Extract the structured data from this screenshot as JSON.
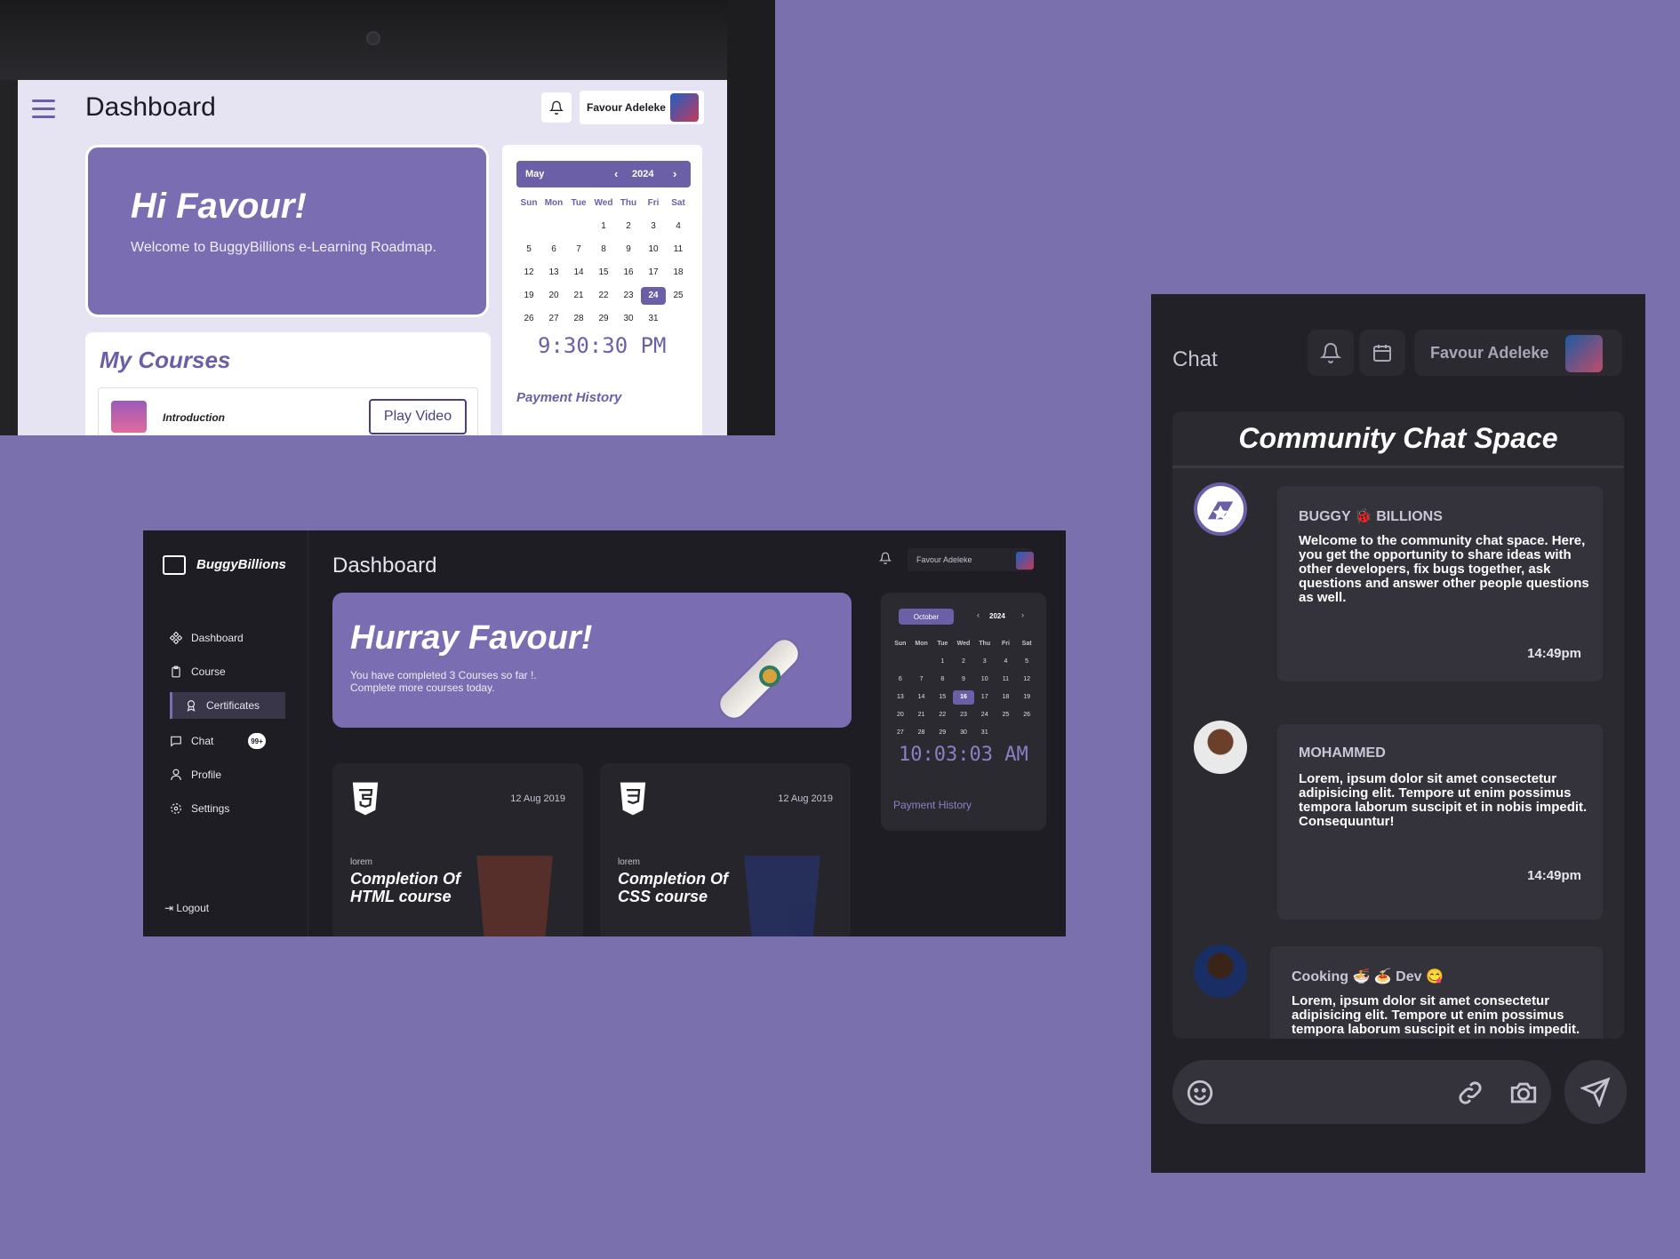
{
  "tablet": {
    "title": "Dashboard",
    "user_name": "Favour Adeleke",
    "hero_heading": "Hi Favour!",
    "hero_sub": "Welcome to BuggyBillions e-Learning Roadmap.",
    "courses_title": "My Courses",
    "course_name": "Introduction",
    "play_button": "Play Video",
    "calendar": {
      "month": "May",
      "year": "2024",
      "day_names": [
        "Sun",
        "Mon",
        "Tue",
        "Wed",
        "Thu",
        "Fri",
        "Sat"
      ],
      "days": [
        "",
        "",
        "",
        "1",
        "2",
        "3",
        "4",
        "5",
        "6",
        "7",
        "8",
        "9",
        "10",
        "11",
        "12",
        "13",
        "14",
        "15",
        "16",
        "17",
        "18",
        "19",
        "20",
        "21",
        "22",
        "23",
        "24",
        "25",
        "26",
        "27",
        "28",
        "29",
        "30",
        "31",
        "",
        ""
      ],
      "selected": "24"
    },
    "clock": "9:30:30 PM",
    "payment_history": "Payment History"
  },
  "desktop": {
    "brand": "BuggyBillions",
    "nav": [
      "Dashboard",
      "Course",
      "Certificates",
      "Chat",
      "Profile",
      "Settings"
    ],
    "active_nav": "Certificates",
    "chat_badge": "99+",
    "logout": "Logout",
    "title": "Dashboard",
    "user_name": "Favour Adeleke",
    "hero_heading": "Hurray Favour!",
    "hero_sub": "You have completed 3 Courses so far !. Complete more courses today.",
    "certificates": [
      {
        "date": "12 Aug 2019",
        "label": "lorem",
        "title": "Completion Of HTML course",
        "icon": "html5-icon",
        "accent": "#e44d26"
      },
      {
        "date": "12 Aug 2019",
        "label": "lorem",
        "title": "Completion Of CSS course",
        "icon": "css3-icon",
        "accent": "#264de4"
      }
    ],
    "calendar": {
      "month": "October",
      "year": "2024",
      "day_names": [
        "Sun",
        "Mon",
        "Tue",
        "Wed",
        "Thu",
        "Fri",
        "Sat"
      ],
      "days": [
        "",
        "",
        "1",
        "2",
        "3",
        "4",
        "5",
        "6",
        "7",
        "8",
        "9",
        "10",
        "11",
        "12",
        "13",
        "14",
        "15",
        "16",
        "17",
        "18",
        "19",
        "20",
        "21",
        "22",
        "23",
        "24",
        "25",
        "26",
        "27",
        "28",
        "29",
        "30",
        "31",
        "",
        ""
      ],
      "selected": "16"
    },
    "clock": "10:03:03 AM",
    "payment_history": "Payment History"
  },
  "chat": {
    "title": "Chat",
    "user_name": "Favour Adeleke",
    "panel_title": "Community Chat Space",
    "messages": [
      {
        "name": "BUGGY 🐞 BILLIONS",
        "text": "Welcome to the community chat space. Here, you get the opportunity to share ideas with other developers, fix bugs together, ask questions and answer other people questions as well.",
        "time": "14:49pm"
      },
      {
        "name": "MOHAMMED",
        "text": "Lorem, ipsum dolor sit amet consectetur adipisicing elit. Tempore ut enim possimus tempora laborum suscipit et in nobis impedit. Consequuntur!",
        "time": "14:49pm"
      },
      {
        "name": "Cooking 🍜 🍝 Dev 😋",
        "text": "Lorem, ipsum dolor sit amet consectetur adipisicing elit. Tempore ut enim possimus tempora laborum suscipit et in nobis impedit.",
        "time": ""
      }
    ]
  },
  "colors": {
    "background": "#7a70ad",
    "accent": "#6b5fa8",
    "dark_bg": "#1e1d23"
  }
}
